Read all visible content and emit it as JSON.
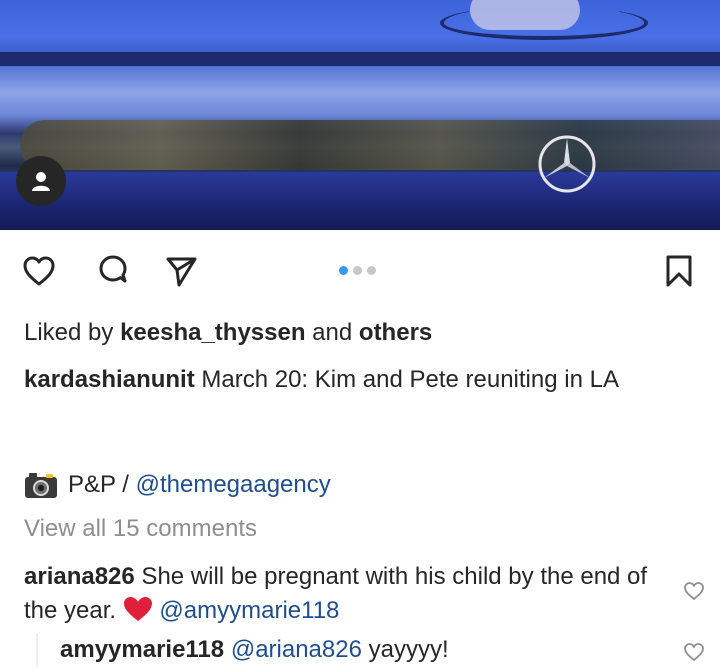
{
  "post": {
    "liked_by_prefix": "Liked by ",
    "liked_by_user": "keesha_thyssen",
    "liked_by_and": " and ",
    "liked_by_others": "others",
    "caption_user": "kardashianunit",
    "caption_text": " March 20: Kim and Pete reuniting in LA",
    "credit_prefix": "P&P / ",
    "credit_handle": "@themegaagency",
    "view_all_comments": "View all 15 comments"
  },
  "carousel": {
    "count": 3,
    "active_index": 0
  },
  "comments": [
    {
      "user": "ariana826",
      "text": " She will be pregnant with his child by the end of the year. ",
      "mention": "@amyymarie118"
    }
  ],
  "replies": [
    {
      "user": "amyymarie118",
      "mention": "@ariana826",
      "text": " yayyyy!"
    }
  ],
  "icons": {
    "like": "heart-icon",
    "comment": "comment-icon",
    "share": "send-icon",
    "save": "bookmark-icon",
    "user_tag": "user-icon",
    "credit": "camera-icon"
  },
  "colors": {
    "link": "#1f4e8c",
    "active_dot": "#3897f0",
    "heart_emoji": "#e0203a"
  }
}
